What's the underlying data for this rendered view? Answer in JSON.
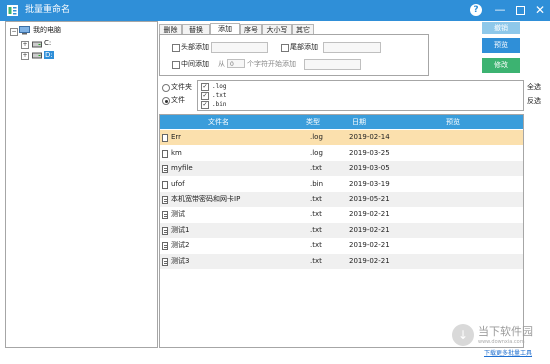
{
  "window": {
    "title": "批量重命名",
    "help_label": "?",
    "minimize_label": "—",
    "close_label": "✕"
  },
  "tree": {
    "root_label": "我的电脑",
    "drives": [
      {
        "label": "C:"
      },
      {
        "label": "D:"
      }
    ]
  },
  "tabs": [
    "删除",
    "替换",
    "添加",
    "序号",
    "大小写",
    "其它"
  ],
  "active_tab": "添加",
  "add_panel": {
    "head_label": "头部添加",
    "tail_label": "尾部添加",
    "middle_label": "中间添加",
    "from_label": "从",
    "position_value": "0",
    "after_label": "个字符开始添加"
  },
  "buttons": {
    "top": "撤销",
    "preview": "预览",
    "modify": "修改"
  },
  "filter": {
    "folder_label": "文件夹",
    "file_label": "文件",
    "types": [
      ".log",
      ".txt",
      ".bin"
    ],
    "select_all": "全选",
    "invert": "反选"
  },
  "table": {
    "headers": [
      "文件名",
      "类型",
      "日期",
      "预览"
    ],
    "rows": [
      {
        "name": "Err",
        "type": ".log",
        "date": "2019-02-14",
        "preview": ""
      },
      {
        "name": "km",
        "type": ".log",
        "date": "2019-03-25",
        "preview": ""
      },
      {
        "name": "myfile",
        "type": ".txt",
        "date": "2019-03-05",
        "preview": ""
      },
      {
        "name": "ufof",
        "type": ".bin",
        "date": "2019-03-19",
        "preview": ""
      },
      {
        "name": "本机宽带密码和网卡IP",
        "type": ".txt",
        "date": "2019-05-21",
        "preview": ""
      },
      {
        "name": "测试",
        "type": ".txt",
        "date": "2019-02-21",
        "preview": ""
      },
      {
        "name": "测试1",
        "type": ".txt",
        "date": "2019-02-21",
        "preview": ""
      },
      {
        "name": "测试2",
        "type": ".txt",
        "date": "2019-02-21",
        "preview": ""
      },
      {
        "name": "测试3",
        "type": ".txt",
        "date": "2019-02-21",
        "preview": ""
      }
    ]
  },
  "watermark": {
    "site": "当下软件园",
    "url": "www.downxia.com",
    "link": "下载更多批量工具"
  },
  "colors": {
    "titlebar": "#2f8fd8",
    "table_header": "#3a9ddb",
    "selected_row": "#fbe0ad",
    "preview_button": "#2f8fd8",
    "modify_button": "#3cb371"
  }
}
